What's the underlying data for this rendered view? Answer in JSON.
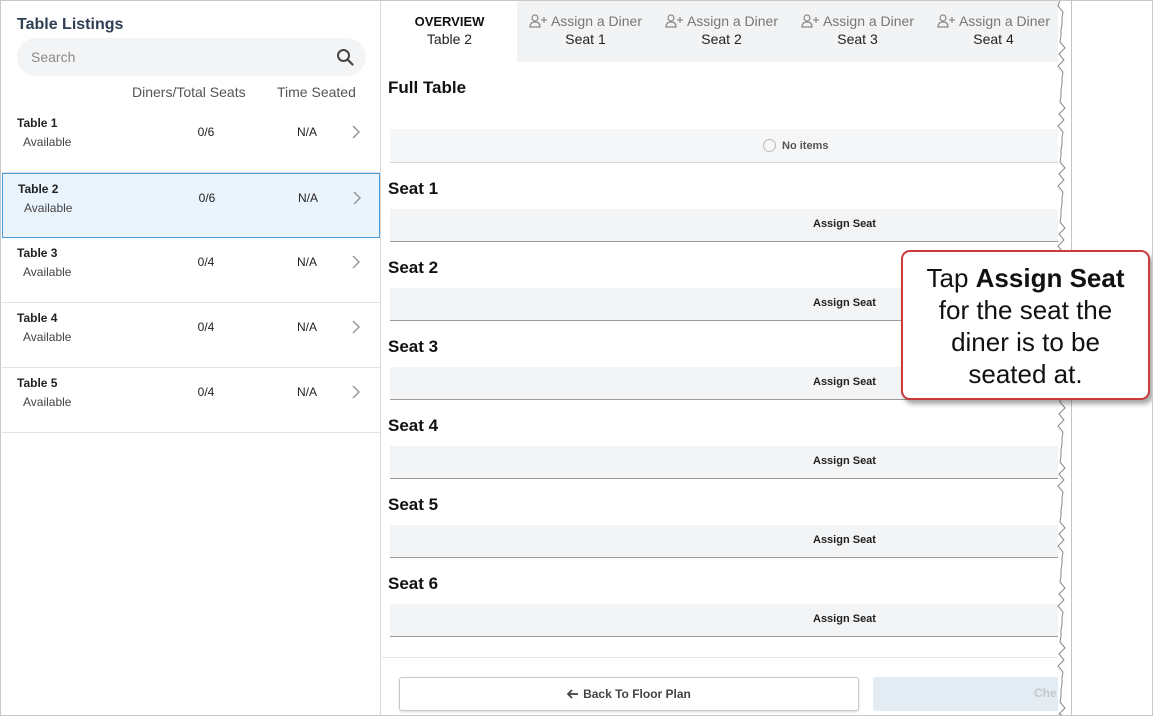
{
  "left_panel": {
    "title": "Table Listings",
    "search_placeholder": "Search",
    "col_diners": "Diners/Total Seats",
    "col_time": "Time Seated",
    "tables": [
      {
        "name": "Table 1",
        "status": "Available",
        "seats": "0/6",
        "time": "N/A",
        "selected": false
      },
      {
        "name": "Table 2",
        "status": "Available",
        "seats": "0/6",
        "time": "N/A",
        "selected": true
      },
      {
        "name": "Table 3",
        "status": "Available",
        "seats": "0/4",
        "time": "N/A",
        "selected": false
      },
      {
        "name": "Table 4",
        "status": "Available",
        "seats": "0/4",
        "time": "N/A",
        "selected": false
      },
      {
        "name": "Table 5",
        "status": "Available",
        "seats": "0/4",
        "time": "N/A",
        "selected": false
      }
    ]
  },
  "tabs": [
    {
      "top": "OVERVIEW",
      "bottom": "Table 2",
      "active": true,
      "icon": ""
    },
    {
      "top": "Assign a Diner",
      "bottom": "Seat 1",
      "active": false,
      "icon": "person-add-icon"
    },
    {
      "top": "Assign a Diner",
      "bottom": "Seat 2",
      "active": false,
      "icon": "person-add-icon"
    },
    {
      "top": "Assign a Diner",
      "bottom": "Seat 3",
      "active": false,
      "icon": "person-add-icon"
    },
    {
      "top": "Assign a Diner",
      "bottom": "Seat 4",
      "active": false,
      "icon": "person-add-icon"
    }
  ],
  "main": {
    "full_table_title": "Full Table",
    "no_items": "No items",
    "seats": [
      {
        "title": "Seat 1",
        "action": "Assign Seat"
      },
      {
        "title": "Seat 2",
        "action": "Assign Seat"
      },
      {
        "title": "Seat 3",
        "action": "Assign Seat"
      },
      {
        "title": "Seat 4",
        "action": "Assign Seat"
      },
      {
        "title": "Seat 5",
        "action": "Assign Seat"
      },
      {
        "title": "Seat 6",
        "action": "Assign Seat"
      }
    ]
  },
  "footer": {
    "back_label": "Back To Floor Plan",
    "checkout_label": "Che"
  },
  "callout": {
    "line1_pre": "Tap ",
    "line1_bold": "Assign Seat",
    "rest": "for the seat the diner is to be seated at."
  },
  "colors": {
    "accent": "#4a9bd6",
    "callout_border": "#cc3b3b",
    "title_text": "#2f3f55"
  }
}
